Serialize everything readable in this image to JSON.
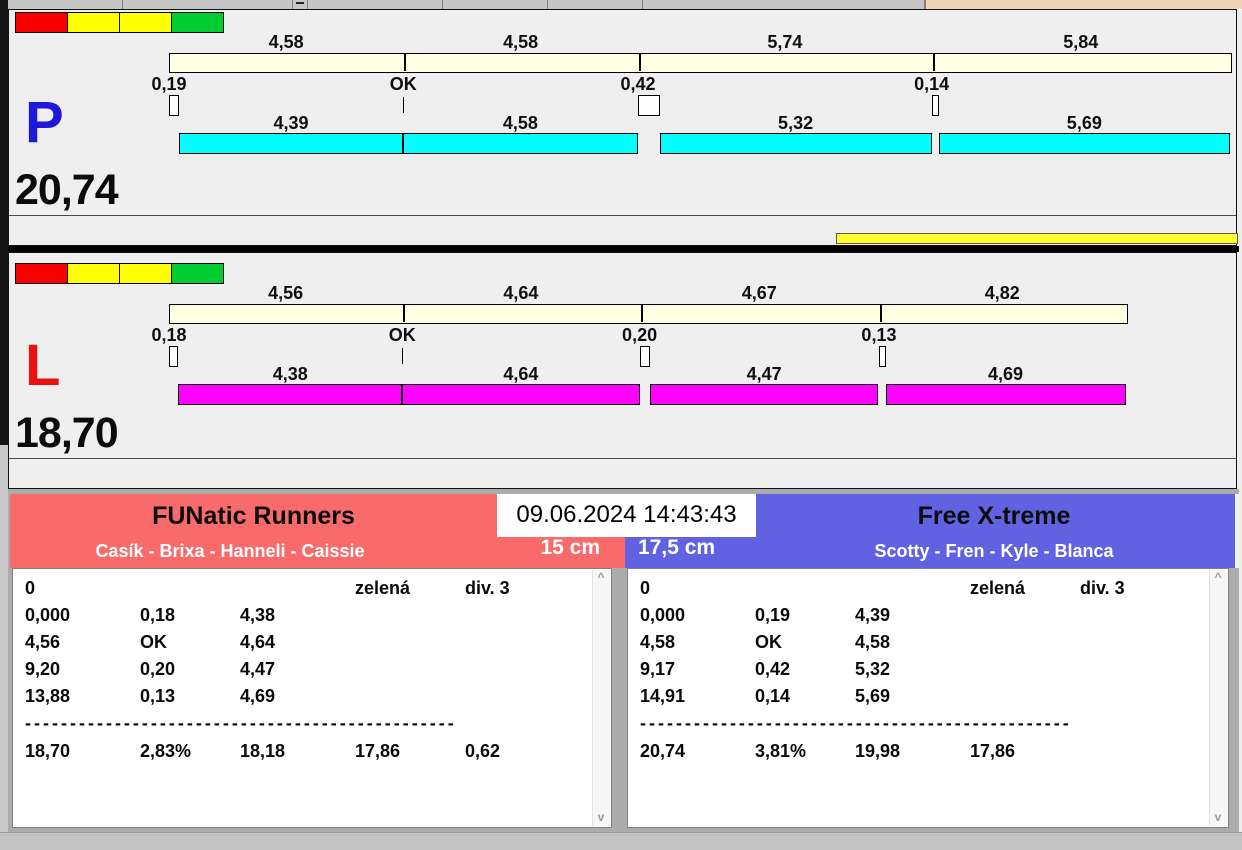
{
  "meta": {
    "datetime": "09.06.2024 14:43:43"
  },
  "colors": {
    "status_boxes": [
      "#f80000",
      "#ffff00",
      "#ffff00",
      "#00cd32"
    ],
    "crossing_bar": "#ffffe1",
    "lane_p_dog_bar": "#00ffff",
    "lane_l_dog_bar": "#ff00ff",
    "yellow_bar": "#ffff2e",
    "team_left_bg": "#f96a6a",
    "team_right_bg": "#6062e2",
    "letter_p": "#2018d8",
    "letter_l": "#e91111"
  },
  "lanes": [
    {
      "letter": "P",
      "letter_color": "#2018d8",
      "total_label": "20,74",
      "total_seconds": 20.74,
      "dog_bar_color": "#00ffff",
      "crossing_segments": [
        {
          "label": "4,58",
          "start": 0,
          "end": 4.58
        },
        {
          "label": "4,58",
          "start": 4.58,
          "end": 9.17
        },
        {
          "label": "5,74",
          "start": 9.17,
          "end": 14.91
        },
        {
          "label": "5,84",
          "start": 14.91,
          "end": 20.74
        }
      ],
      "pass_marks": [
        {
          "label": "0,19",
          "time": 0,
          "gap": 0.19
        },
        {
          "label": "OK",
          "time": 4.58,
          "gap": 0
        },
        {
          "label": "0,42",
          "time": 9.17,
          "gap": 0.42
        },
        {
          "label": "0,14",
          "time": 14.91,
          "gap": 0.14
        }
      ],
      "dog_segments": [
        {
          "label": "4,39",
          "start": 0.19,
          "end": 4.58
        },
        {
          "label": "4,58",
          "start": 4.58,
          "end": 9.16
        },
        {
          "label": "5,32",
          "start": 9.59,
          "end": 14.91
        },
        {
          "label": "5,69",
          "start": 15.05,
          "end": 20.74
        }
      ],
      "has_yellow_bar": true
    },
    {
      "letter": "L",
      "letter_color": "#e91111",
      "total_label": "18,70",
      "total_seconds": 18.7,
      "dog_bar_color": "#ff00ff",
      "crossing_segments": [
        {
          "label": "4,56",
          "start": 0,
          "end": 4.56
        },
        {
          "label": "4,64",
          "start": 4.56,
          "end": 9.2
        },
        {
          "label": "4,67",
          "start": 9.2,
          "end": 13.88
        },
        {
          "label": "4,82",
          "start": 13.88,
          "end": 18.7
        }
      ],
      "pass_marks": [
        {
          "label": "0,18",
          "time": 0,
          "gap": 0.18
        },
        {
          "label": "OK",
          "time": 4.56,
          "gap": 0
        },
        {
          "label": "0,20",
          "time": 9.2,
          "gap": 0.2
        },
        {
          "label": "0,13",
          "time": 13.88,
          "gap": 0.13
        }
      ],
      "dog_segments": [
        {
          "label": "4,38",
          "start": 0.18,
          "end": 4.56
        },
        {
          "label": "4,64",
          "start": 4.56,
          "end": 9.2
        },
        {
          "label": "4,47",
          "start": 9.4,
          "end": 13.87
        },
        {
          "label": "4,69",
          "start": 14.01,
          "end": 18.7
        }
      ],
      "has_yellow_bar": false
    }
  ],
  "teams": [
    {
      "name": "FUNatic Runners",
      "members": "Casík - Brixa - Hanneli - Caissie",
      "jump_height": "15 cm",
      "info_row": [
        "0",
        "",
        "",
        "zelená",
        "div. 3"
      ],
      "rows": [
        [
          "0,000",
          "0,18",
          "4,38",
          "",
          ""
        ],
        [
          "4,56",
          "OK",
          "4,64",
          "",
          ""
        ],
        [
          "9,20",
          "0,20",
          "4,47",
          "",
          ""
        ],
        [
          "13,88",
          "0,13",
          "4,69",
          "",
          ""
        ]
      ],
      "divider": "------------------------------------------------",
      "totals": [
        "18,70",
        "2,83%",
        "18,18",
        "17,86",
        "0,62"
      ]
    },
    {
      "name": "Free X-treme",
      "members": "Scotty - Fren - Kyle - Blanca",
      "jump_height": "17,5 cm",
      "info_row": [
        "0",
        "",
        "",
        "zelená",
        "div. 3"
      ],
      "rows": [
        [
          "0,000",
          "0,19",
          "4,39",
          "",
          ""
        ],
        [
          "4,58",
          "OK",
          "4,58",
          "",
          ""
        ],
        [
          "9,17",
          "0,42",
          "5,32",
          "",
          ""
        ],
        [
          "14,91",
          "0,14",
          "5,69",
          "",
          ""
        ]
      ],
      "divider": "------------------------------------------------",
      "totals": [
        "20,74",
        "3,81%",
        "19,98",
        "17,86",
        ""
      ]
    }
  ],
  "scrollbar": {
    "up_glyph": "^",
    "down_glyph": "v"
  }
}
